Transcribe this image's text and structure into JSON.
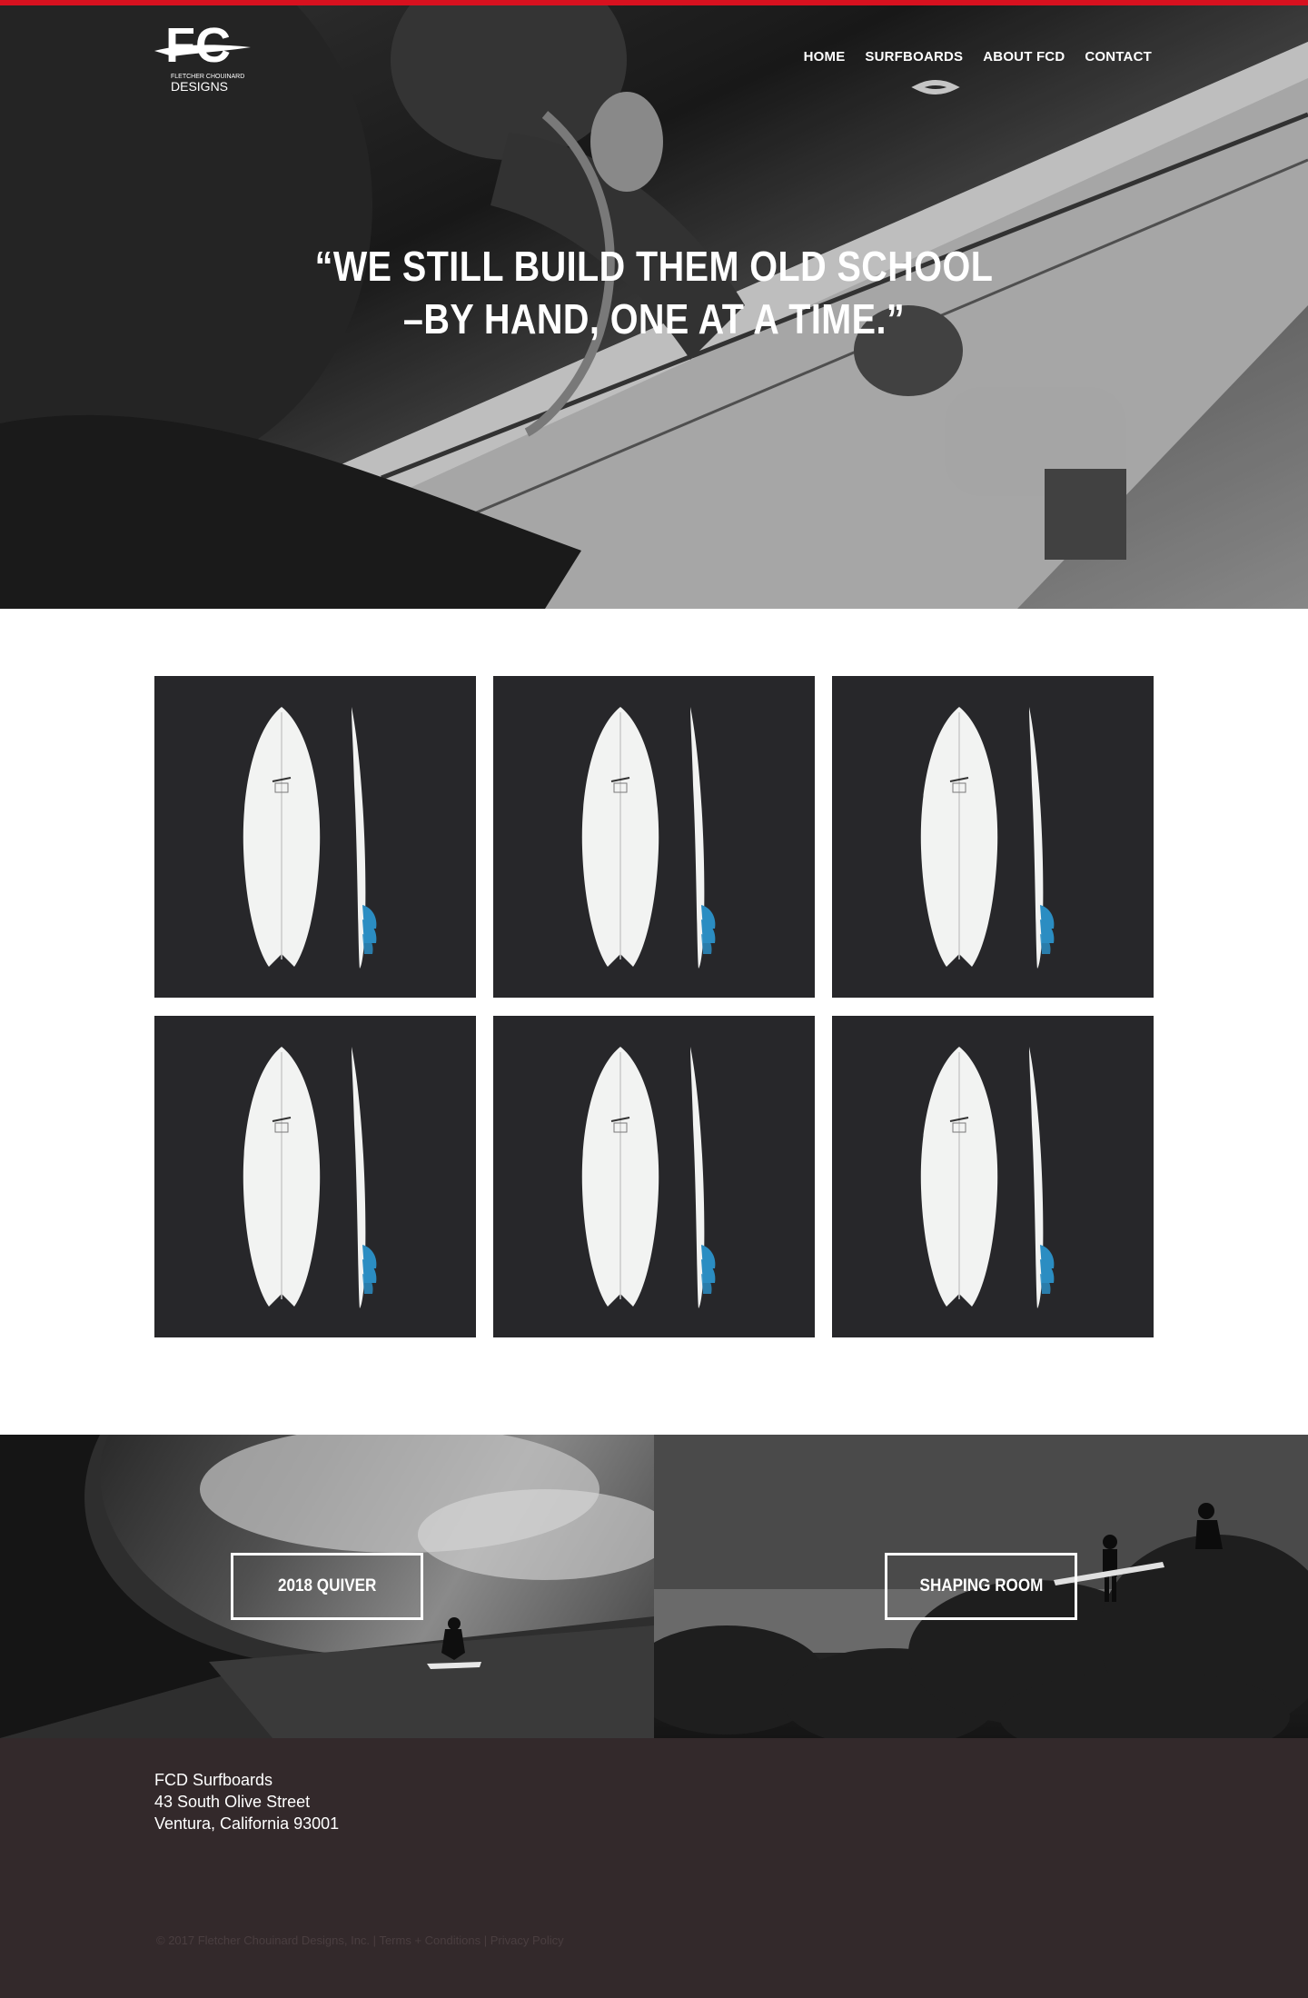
{
  "brand": {
    "logo_text": "FC",
    "logo_line1": "FLETCHER CHOUINARD",
    "logo_line2": "DESIGNS",
    "accent_color": "#d7111f"
  },
  "nav": {
    "items": [
      "HOME",
      "SURFBOARDS",
      "ABOUT FCD",
      "CONTACT"
    ]
  },
  "hero": {
    "quote_line1": "“WE STILL BUILD THEM OLD SCHOOL",
    "quote_line2": "–BY HAND, ONE AT A TIME.”"
  },
  "products": {
    "count": 6,
    "tile_color": "#27272a",
    "fin_color": "#2b8dc2"
  },
  "promos": {
    "left_button": "2018 QUIVER",
    "right_button": "SHAPING ROOM"
  },
  "footer": {
    "company": "FCD Surfboards",
    "street": "43 South Olive Street",
    "city": "Ventura, California 93001",
    "copyright": "© 2017 Fletcher Chouinard Designs, Inc.",
    "separator": "|",
    "terms": "Terms + Conditions",
    "privacy": "Privacy Policy"
  }
}
